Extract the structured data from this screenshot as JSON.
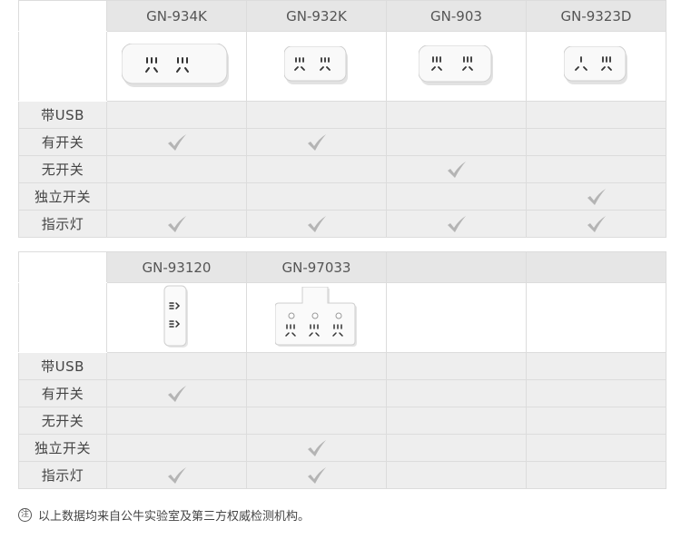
{
  "table1": {
    "products": [
      "GN-934K",
      "GN-932K",
      "GN-903",
      "GN-9323D"
    ],
    "features": [
      {
        "label": "带USB",
        "checks": [
          false,
          false,
          false,
          false
        ]
      },
      {
        "label": "有开关",
        "checks": [
          true,
          true,
          false,
          false
        ]
      },
      {
        "label": "无开关",
        "checks": [
          false,
          false,
          true,
          false
        ]
      },
      {
        "label": "独立开关",
        "checks": [
          false,
          false,
          false,
          true
        ]
      },
      {
        "label": "指示灯",
        "checks": [
          true,
          true,
          true,
          true
        ]
      }
    ]
  },
  "table2": {
    "products": [
      "GN-93120",
      "GN-97033",
      "",
      ""
    ],
    "features": [
      {
        "label": "带USB",
        "checks": [
          false,
          false,
          false,
          false
        ]
      },
      {
        "label": "有开关",
        "checks": [
          true,
          false,
          false,
          false
        ]
      },
      {
        "label": "无开关",
        "checks": [
          false,
          false,
          false,
          false
        ]
      },
      {
        "label": "独立开关",
        "checks": [
          false,
          true,
          false,
          false
        ]
      },
      {
        "label": "指示灯",
        "checks": [
          true,
          true,
          false,
          false
        ]
      }
    ]
  },
  "footnote": {
    "icon": "注",
    "text": "以上数据均来自公牛实验室及第三方权威检测机构。"
  },
  "colors": {
    "header_bg": "#e6e6e6",
    "row_bg": "#eeeeee",
    "check": "#b4b4b4",
    "border": "#dcdcdc"
  }
}
